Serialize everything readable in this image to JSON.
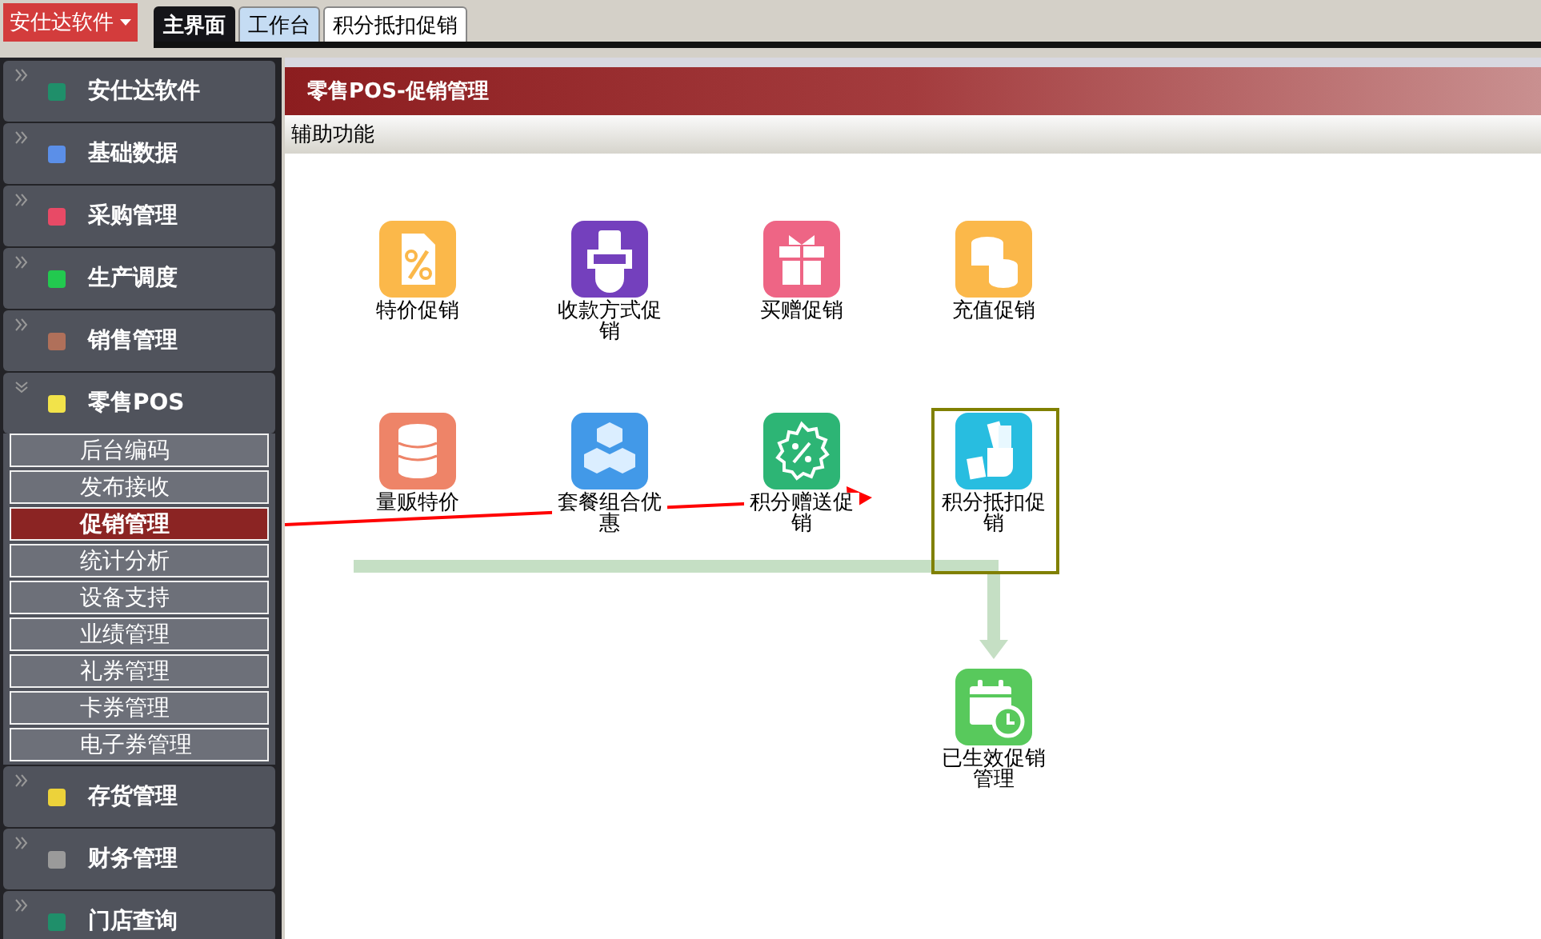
{
  "app_menu": {
    "label": "安仕达软件"
  },
  "tabs": [
    {
      "label": "主界面",
      "selected": true,
      "highlighted": false
    },
    {
      "label": "工作台",
      "selected": false,
      "highlighted": true
    },
    {
      "label": "积分抵扣促销",
      "selected": false,
      "highlighted": false
    }
  ],
  "sidebar": {
    "items": [
      {
        "label": "安仕达软件",
        "color": "#1f8f6a",
        "expanded": false
      },
      {
        "label": "基础数据",
        "color": "#5b8fe8",
        "expanded": false
      },
      {
        "label": "采购管理",
        "color": "#e84a66",
        "expanded": false
      },
      {
        "label": "生产调度",
        "color": "#22c94f",
        "expanded": false
      },
      {
        "label": "销售管理",
        "color": "#b0705a",
        "expanded": false
      },
      {
        "label": "零售POS",
        "color": "#f2e34a",
        "expanded": true,
        "children": [
          {
            "label": "后台编码",
            "selected": false
          },
          {
            "label": "发布接收",
            "selected": false
          },
          {
            "label": "促销管理",
            "selected": true
          },
          {
            "label": "统计分析",
            "selected": false
          },
          {
            "label": "设备支持",
            "selected": false
          },
          {
            "label": "业绩管理",
            "selected": false
          },
          {
            "label": "礼券管理",
            "selected": false
          },
          {
            "label": "卡券管理",
            "selected": false
          },
          {
            "label": "电子券管理",
            "selected": false
          }
        ]
      },
      {
        "label": "存货管理",
        "color": "#ecd23a",
        "expanded": false
      },
      {
        "label": "财务管理",
        "color": "#9a9a9a",
        "expanded": false
      },
      {
        "label": "门店查询",
        "color": "#1f8f6a",
        "expanded": false
      }
    ]
  },
  "panel": {
    "title": "零售POS-促销管理",
    "section": "辅助功能",
    "functions": [
      {
        "label": "特价促销",
        "color": "#fbb84a",
        "selected": false
      },
      {
        "label": "收款方式促销",
        "color": "#7440bd",
        "selected": false
      },
      {
        "label": "买赠促销",
        "color": "#ee6585",
        "selected": false
      },
      {
        "label": "充值促销",
        "color": "#fbb84a",
        "selected": false
      },
      {
        "label": "量贩特价",
        "color": "#ee8468",
        "selected": false
      },
      {
        "label": "套餐组合优惠",
        "color": "#4299e8",
        "selected": false
      },
      {
        "label": "积分赠送促销",
        "color": "#2db575",
        "selected": false
      },
      {
        "label": "积分抵扣促销",
        "color": "#28bde0",
        "selected": true
      },
      {
        "label": "已生效促销管理",
        "color": "#58c95c",
        "selected": false
      }
    ]
  }
}
